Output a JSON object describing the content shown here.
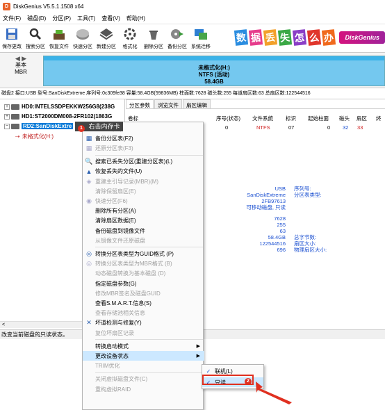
{
  "app": {
    "title": "DiskGenius V5.5.1.1508 x64",
    "icon": "D"
  },
  "menu": [
    "文件(F)",
    "磁盘(D)",
    "分区(P)",
    "工具(T)",
    "查看(V)",
    "帮助(H)"
  ],
  "toolbar": [
    {
      "label": "保存更改",
      "icon": "save-icon"
    },
    {
      "label": "搜索分区",
      "icon": "search-icon"
    },
    {
      "label": "恢复文件",
      "icon": "recover-icon"
    },
    {
      "label": "快速分区",
      "icon": "quick-partition-icon"
    },
    {
      "label": "新建分区",
      "icon": "new-partition-icon"
    },
    {
      "label": "格式化",
      "icon": "format-icon"
    },
    {
      "label": "删除分区",
      "icon": "delete-icon"
    },
    {
      "label": "备份分区",
      "icon": "backup-icon"
    },
    {
      "label": "系统迁移",
      "icon": "migrate-icon"
    }
  ],
  "banner": {
    "chars": [
      "数",
      "据",
      "丢",
      "失",
      "怎",
      "么",
      "办"
    ],
    "brand": "DiskGenius"
  },
  "disk": {
    "type_top": "基本",
    "type_bottom": "MBR"
  },
  "partition_bar": {
    "line1": "未格式化(H:)",
    "line2": "NTFS (活动)",
    "line3": "58.4GB"
  },
  "info_line": "磁盘2 接口:USB  型号:SanDiskExtreme  序列号:0c309fe38  容量:58.4GB(59836MB)  柱面数:7628  磁头数:255  每道扇区数:63  总扇区数:122544516",
  "tree": {
    "hd0": "HD0:INTELSSDPEKKW256G8(238G",
    "hd1": "HD1:ST2000DM008-2FR102(1863G",
    "rd2": "RD2:SanDiskExtre",
    "partition": "未格式化(H:)"
  },
  "tabs": [
    "分区参数",
    "浏览文件",
    "扇区编辑"
  ],
  "table": {
    "headers": [
      "卷标",
      "序号(状态)",
      "文件系统",
      "标识",
      "起始柱面",
      "磁头",
      "扇区",
      "终"
    ],
    "row": [
      "",
      "0",
      "NTFS",
      "07",
      "0",
      "32",
      "33"
    ]
  },
  "props_right": [
    "USB",
    "SanDiskExtreme",
    "2FB97613",
    "可移动磁盘, 只读"
  ],
  "props_right_labels": [
    "序列号:",
    "分区表类型:"
  ],
  "props_nums": [
    "7628",
    "255",
    "63",
    "58.4GB",
    "122544516",
    "696"
  ],
  "props_num_labels": [
    "总字节数:",
    "扇区大小:",
    "物理扇区大小:"
  ],
  "status": "改变当前磁盘的只读状态。",
  "callout": {
    "text": "右击内存卡",
    "badge": "1"
  },
  "context_menu": [
    {
      "label": "分区表(F8)",
      "disabled": true,
      "icon": ""
    },
    {
      "label": "备份分区表(F2)",
      "disabled": false,
      "icon": "backup-table-icon"
    },
    {
      "label": "还原分区表(F3)",
      "disabled": true,
      "icon": "restore-table-icon"
    },
    {
      "sep": true
    },
    {
      "label": "搜索已丢失分区(重建分区表)(L)",
      "disabled": false,
      "icon": "search-icon"
    },
    {
      "label": "恢复丢失的文件(U)",
      "disabled": false,
      "icon": "recover-icon"
    },
    {
      "label": "重建主引导记录(MBR)(M)",
      "disabled": true,
      "icon": "mbr-icon"
    },
    {
      "label": "清除保留扇区(E)",
      "disabled": true,
      "icon": ""
    },
    {
      "label": "快速分区(F6)",
      "disabled": true,
      "icon": "quick-partition-icon"
    },
    {
      "label": "删除所有分区(A)",
      "disabled": false,
      "icon": ""
    },
    {
      "label": "清除扇区数据(E)",
      "disabled": false,
      "icon": ""
    },
    {
      "label": "备份磁盘到镜像文件",
      "disabled": false,
      "icon": ""
    },
    {
      "label": "从镜像文件还原磁盘",
      "disabled": true,
      "icon": ""
    },
    {
      "sep": true
    },
    {
      "label": "转换分区表类型为GUID格式 (P)",
      "disabled": false,
      "icon": "convert-icon"
    },
    {
      "label": "转换分区表类型为MBR格式 (B)",
      "disabled": true,
      "icon": "convert-mbr-icon"
    },
    {
      "label": "动态磁盘转换为基本磁盘 (D)",
      "disabled": true,
      "icon": ""
    },
    {
      "label": "指定磁盘参数(G)",
      "disabled": false,
      "icon": ""
    },
    {
      "label": "修改MBR签名及磁盘GUID",
      "disabled": true,
      "icon": ""
    },
    {
      "label": "查看S.M.A.R.T.信息(S)",
      "disabled": false,
      "icon": ""
    },
    {
      "label": "查看存储池相关信息",
      "disabled": true,
      "icon": ""
    },
    {
      "label": "坏道检测与修复(Y)",
      "disabled": false,
      "icon": "repair-icon"
    },
    {
      "label": "复位坏扇区记录",
      "disabled": true,
      "icon": ""
    },
    {
      "sep": true
    },
    {
      "label": "转换启动模式",
      "disabled": false,
      "icon": "",
      "arrow": true
    },
    {
      "label": "更改设备状态",
      "disabled": false,
      "icon": "",
      "arrow": true,
      "highlight": true
    },
    {
      "label": "TRIM优化",
      "disabled": true,
      "icon": ""
    },
    {
      "sep": true
    },
    {
      "label": "关闭虚拟磁盘文件(C)",
      "disabled": true,
      "icon": ""
    },
    {
      "label": "重构虚拟RAID",
      "disabled": true,
      "icon": ""
    }
  ],
  "submenu": [
    {
      "label": "联机(L)",
      "checked": true
    },
    {
      "label": "只读",
      "checked": true
    }
  ],
  "badge2": "2",
  "colors": {
    "accent": "#0078d7",
    "red": "#e03020",
    "partition": "#74c8ef"
  }
}
